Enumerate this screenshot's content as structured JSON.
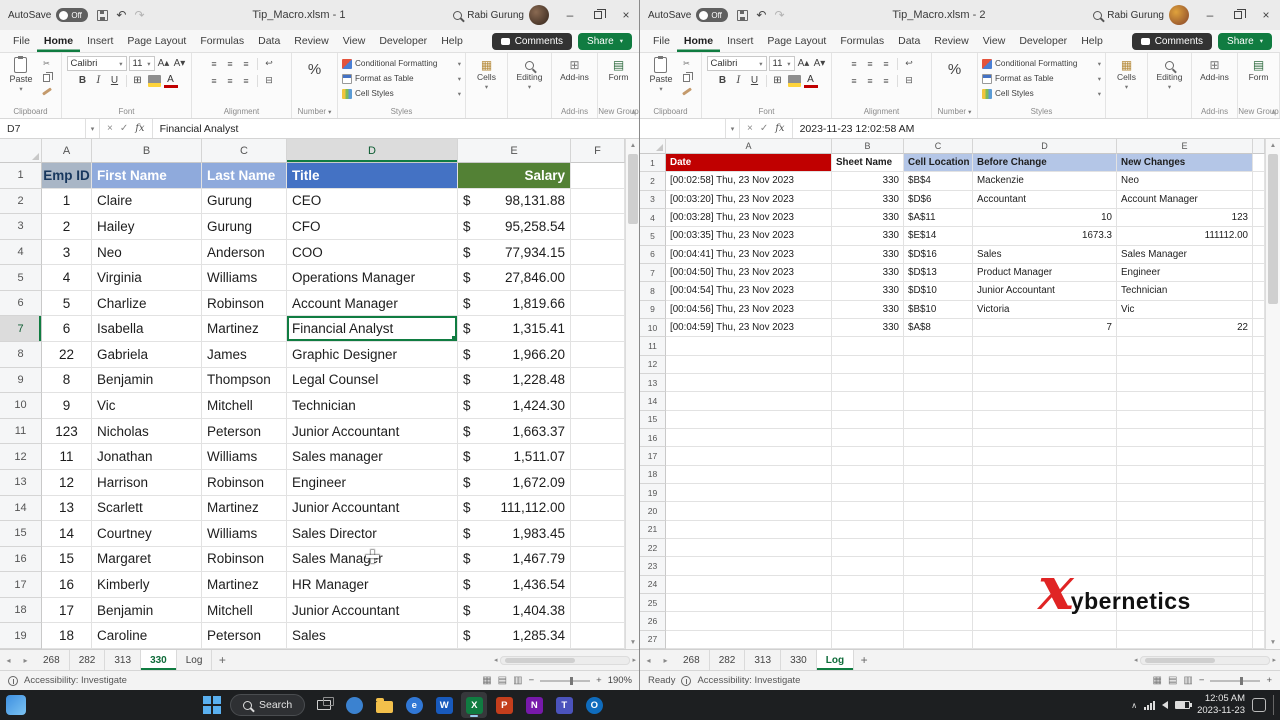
{
  "colors": {
    "excel_green": "#107C41",
    "empid_header_bg": "#A9B6C6",
    "name_header_bg": "#8FAADC",
    "title_header_bg": "#4472C4",
    "salary_header_bg": "#538135",
    "date_header_bg": "#C00000",
    "log_header_bg": "#B4C6E7",
    "logo_red": "#E02424"
  },
  "chrome": {
    "autosave_label": "AutoSave",
    "autosave_state": "Off",
    "user_name": "Rabi Gurung",
    "menu_items": [
      "File",
      "Home",
      "Insert",
      "Page Layout",
      "Formulas",
      "Data",
      "Review",
      "View",
      "Developer",
      "Help"
    ],
    "active_menu": "Home",
    "comments_label": "Comments",
    "share_label": "Share",
    "fx_label": "fx",
    "ribbon": {
      "paste_label": "Paste",
      "clipboard_group": "Clipboard",
      "font_name": "Calibri",
      "font_size": "11",
      "font_group": "Font",
      "alignment_group": "Alignment",
      "percent_symbol": "%",
      "number_group": "Number",
      "conditional_formatting": "Conditional Formatting",
      "format_as_table": "Format as Table",
      "cell_styles": "Cell Styles",
      "styles_group": "Styles",
      "cells_label": "Cells",
      "editing_label": "Editing",
      "addins_label": "Add-ins",
      "form_label": "Form",
      "new_group_label": "New Group"
    }
  },
  "window1": {
    "title": "Tip_Macro.xlsm  -  1",
    "name_box": "D7",
    "formula_text": "Financial Analyst",
    "col_letters": [
      "A",
      "B",
      "C",
      "D",
      "E",
      "F"
    ],
    "selected_cell": {
      "col": "D",
      "row": 7
    },
    "headers": {
      "emp_id": "Emp ID",
      "first_name": "First Name",
      "last_name": "Last Name",
      "title": "Title",
      "salary": "Salary"
    },
    "rows": [
      {
        "id": "1",
        "first": "Claire",
        "last": "Gurung",
        "title": "CEO",
        "salary": "98,131.88"
      },
      {
        "id": "2",
        "first": "Hailey",
        "last": "Gurung",
        "title": "CFO",
        "salary": "95,258.54"
      },
      {
        "id": "3",
        "first": "Neo",
        "last": "Anderson",
        "title": "COO",
        "salary": "77,934.15"
      },
      {
        "id": "4",
        "first": "Virginia",
        "last": "Williams",
        "title": "Operations Manager",
        "salary": "27,846.00"
      },
      {
        "id": "5",
        "first": "Charlize",
        "last": "Robinson",
        "title": "Account Manager",
        "salary": "1,819.66"
      },
      {
        "id": "6",
        "first": "Isabella",
        "last": "Martinez",
        "title": "Financial Analyst",
        "salary": "1,315.41"
      },
      {
        "id": "22",
        "first": "Gabriela",
        "last": "James",
        "title": "Graphic Designer",
        "salary": "1,966.20"
      },
      {
        "id": "8",
        "first": "Benjamin",
        "last": "Thompson",
        "title": "Legal Counsel",
        "salary": "1,228.48"
      },
      {
        "id": "9",
        "first": "Vic",
        "last": "Mitchell",
        "title": "Technician",
        "salary": "1,424.30"
      },
      {
        "id": "123",
        "first": "Nicholas",
        "last": "Peterson",
        "title": "Junior Accountant",
        "salary": "1,663.37"
      },
      {
        "id": "11",
        "first": "Jonathan",
        "last": "Williams",
        "title": "Sales manager",
        "salary": "1,511.07"
      },
      {
        "id": "12",
        "first": "Harrison",
        "last": "Robinson",
        "title": "Engineer",
        "salary": "1,672.09"
      },
      {
        "id": "13",
        "first": "Scarlett",
        "last": "Martinez",
        "title": "Junior Accountant",
        "salary": "111,112.00"
      },
      {
        "id": "14",
        "first": "Courtney",
        "last": "Williams",
        "title": "Sales Director",
        "salary": "1,983.45"
      },
      {
        "id": "15",
        "first": "Margaret",
        "last": "Robinson",
        "title": "Sales Manager",
        "salary": "1,467.79"
      },
      {
        "id": "16",
        "first": "Kimberly",
        "last": "Martinez",
        "title": "HR Manager",
        "salary": "1,436.54"
      },
      {
        "id": "17",
        "first": "Benjamin",
        "last": "Mitchell",
        "title": "Junior Accountant",
        "salary": "1,404.38"
      },
      {
        "id": "18",
        "first": "Caroline",
        "last": "Peterson",
        "title": "Sales",
        "salary": "1,285.34"
      }
    ],
    "sheet_tabs": [
      "268",
      "282",
      "313",
      "330",
      "Log"
    ],
    "active_tab": "330",
    "status_left": "Accessibility: Investigate",
    "zoom_level": "190%"
  },
  "window2": {
    "title": "Tip_Macro.xlsm  -  2",
    "name_box": "",
    "formula_text": "2023-11-23 12:02:58 AM",
    "col_letters": [
      "A",
      "B",
      "C",
      "D",
      "E"
    ],
    "headers": {
      "date": "Date",
      "sheet": "Sheet Name",
      "cell": "Cell Location",
      "before": "Before Change",
      "after": "New Changes"
    },
    "rows": [
      {
        "date": "[00:02:58] Thu, 23 Nov 2023",
        "sheet": "330",
        "cell": "$B$4",
        "before": "Mackenzie",
        "after": "Neo"
      },
      {
        "date": "[00:03:20] Thu, 23 Nov 2023",
        "sheet": "330",
        "cell": "$D$6",
        "before": "Accountant",
        "after": "Account Manager"
      },
      {
        "date": "[00:03:28] Thu, 23 Nov 2023",
        "sheet": "330",
        "cell": "$A$11",
        "before": "10",
        "after": "123"
      },
      {
        "date": "[00:03:35] Thu, 23 Nov 2023",
        "sheet": "330",
        "cell": "$E$14",
        "before": "1673.3",
        "after": "111112.00"
      },
      {
        "date": "[00:04:41] Thu, 23 Nov 2023",
        "sheet": "330",
        "cell": "$D$16",
        "before": "Sales",
        "after": "Sales Manager"
      },
      {
        "date": "[00:04:50] Thu, 23 Nov 2023",
        "sheet": "330",
        "cell": "$D$13",
        "before": "Product Manager",
        "after": "Engineer"
      },
      {
        "date": "[00:04:54] Thu, 23 Nov 2023",
        "sheet": "330",
        "cell": "$D$10",
        "before": "Junior Accountant",
        "after": "Technician"
      },
      {
        "date": "[00:04:56] Thu, 23 Nov 2023",
        "sheet": "330",
        "cell": "$B$10",
        "before": "Victoria",
        "after": "Vic"
      },
      {
        "date": "[00:04:59] Thu, 23 Nov 2023",
        "sheet": "330",
        "cell": "$A$8",
        "before": "7",
        "after": "22"
      }
    ],
    "total_rows": 27,
    "sheet_tabs": [
      "268",
      "282",
      "313",
      "330",
      "Log"
    ],
    "active_tab": "Log",
    "status_ready": "Ready",
    "status_left": "Accessibility: Investigate",
    "logo_x": "x",
    "logo_rest": "ybernetics"
  },
  "taskbar": {
    "search_label": "Search",
    "time": "12:05 AM",
    "date": "2023-11-23",
    "app_icons": [
      {
        "name": "task-view",
        "style": "taskview"
      },
      {
        "name": "widgets",
        "style": "circle",
        "color": "#3b82d0",
        "letter": ""
      },
      {
        "name": "file-explorer",
        "style": "folder",
        "color": "#f3c04b"
      },
      {
        "name": "edge-browser",
        "style": "circle",
        "color": "#3178d6",
        "letter": "e"
      },
      {
        "name": "word",
        "style": "square",
        "color": "#185ABD",
        "letter": "W"
      },
      {
        "name": "excel",
        "style": "square",
        "color": "#107C41",
        "letter": "X",
        "active": true
      },
      {
        "name": "powerpoint",
        "style": "square",
        "color": "#C43E1C",
        "letter": "P"
      },
      {
        "name": "onenote",
        "style": "square",
        "color": "#7719AA",
        "letter": "N"
      },
      {
        "name": "teams",
        "style": "square",
        "color": "#4B53BC",
        "letter": "T"
      },
      {
        "name": "outlook",
        "style": "circle",
        "color": "#0F6CBD",
        "letter": "O"
      }
    ]
  }
}
